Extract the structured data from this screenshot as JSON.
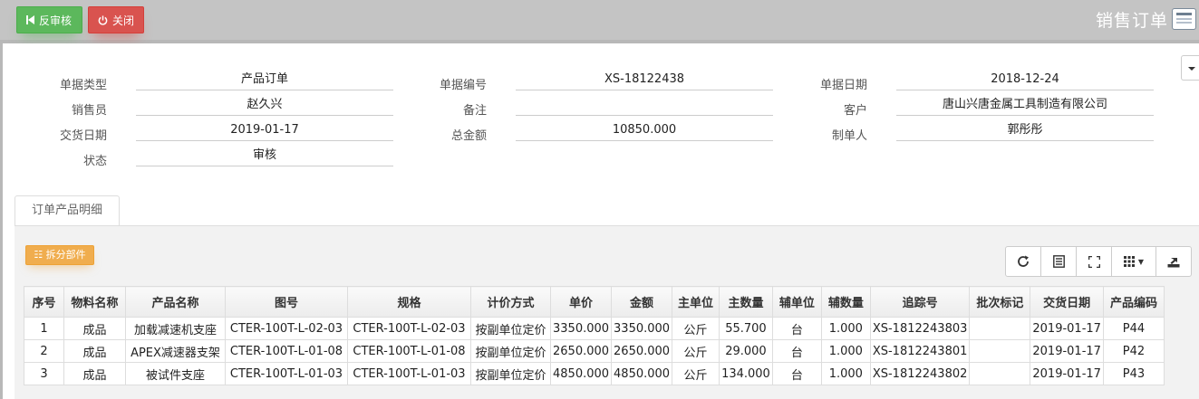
{
  "toolbar": {
    "unaudit_label": "反审核",
    "close_label": "关闭"
  },
  "page_title": "销售订单",
  "header": {
    "fields": [
      {
        "label": "单据类型",
        "value": "产品订单"
      },
      {
        "label": "单据编号",
        "value": "XS-18122438"
      },
      {
        "label": "单据日期",
        "value": "2018-12-24"
      },
      {
        "label": "销售员",
        "value": "赵久兴"
      },
      {
        "label": "备注",
        "value": ""
      },
      {
        "label": "客户",
        "value": "唐山兴唐金属工具制造有限公司"
      },
      {
        "label": "交货日期",
        "value": "2019-01-17"
      },
      {
        "label": "总金额",
        "value": "10850.000"
      },
      {
        "label": "制单人",
        "value": "郭彤彤"
      },
      {
        "label": "状态",
        "value": "审核"
      }
    ]
  },
  "tab": {
    "label": "订单产品明细"
  },
  "detail": {
    "split_label": "拆分部件",
    "columns": [
      "序号",
      "物料名称",
      "产品名称",
      "图号",
      "规格",
      "计价方式",
      "单价",
      "金额",
      "主单位",
      "主数量",
      "辅单位",
      "辅数量",
      "追踪号",
      "批次标记",
      "交货日期",
      "产品编码"
    ],
    "rows": [
      [
        "1",
        "成品",
        "加载减速机支座",
        "CTER-100T-L-02-03",
        "CTER-100T-L-02-03",
        "按副单位定价",
        "3350.000",
        "3350.000",
        "公斤",
        "55.700",
        "台",
        "1.000",
        "XS-1812243803",
        "",
        "2019-01-17",
        "P44"
      ],
      [
        "2",
        "成品",
        "APEX减速器支架",
        "CTER-100T-L-01-08",
        "CTER-100T-L-01-08",
        "按副单位定价",
        "2650.000",
        "2650.000",
        "公斤",
        "29.000",
        "台",
        "1.000",
        "XS-1812243801",
        "",
        "2019-01-17",
        "P42"
      ],
      [
        "3",
        "成品",
        "被试件支座",
        "CTER-100T-L-01-03",
        "CTER-100T-L-01-03",
        "按副单位定价",
        "4850.000",
        "4850.000",
        "公斤",
        "134.000",
        "台",
        "1.000",
        "XS-1812243802",
        "",
        "2019-01-17",
        "P43"
      ]
    ]
  },
  "icons": [
    "backward-icon",
    "power-icon",
    "form-icon",
    "list-icon",
    "refresh-icon",
    "columns-icon",
    "fullscreen-icon",
    "grid-icon",
    "export-icon"
  ]
}
